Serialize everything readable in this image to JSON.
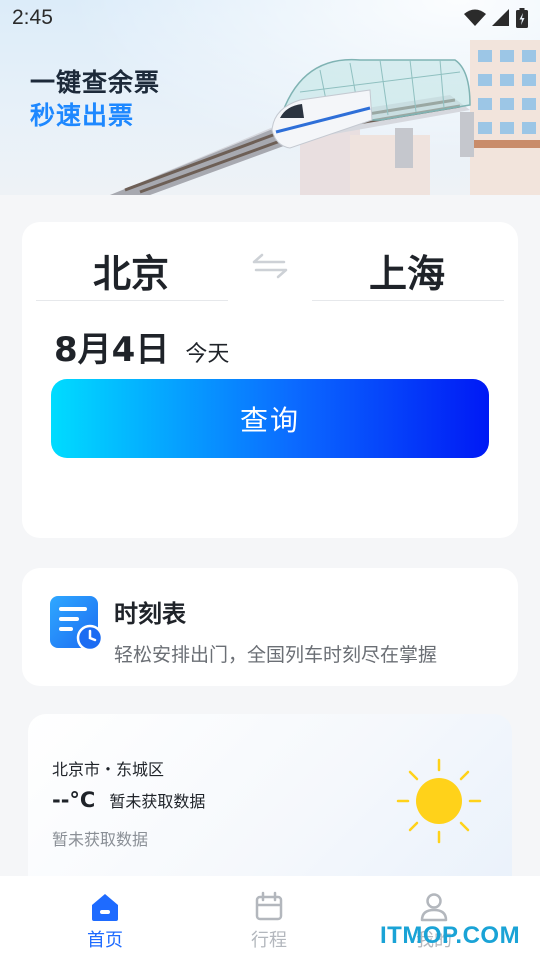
{
  "status_bar": {
    "time": "2:45"
  },
  "hero": {
    "slogan_line1": "一键查余票",
    "slogan_line2": "秒速出票"
  },
  "query": {
    "from_station": "北京",
    "to_station": "上海",
    "date": "8月4日",
    "date_hint": "今天",
    "search_label": "查询"
  },
  "timetable": {
    "title": "时刻表",
    "description": "轻松安排出门，全国列车时刻尽在掌握"
  },
  "weather": {
    "location": "北京市・东城区",
    "temperature": "--°C",
    "condition": "暂未获取数据",
    "note": "暂未获取数据"
  },
  "bottom_nav": {
    "items": [
      {
        "label": "首页",
        "icon": "home-icon",
        "active": true
      },
      {
        "label": "行程",
        "icon": "calendar-icon",
        "active": false
      },
      {
        "label": "我的",
        "icon": "person-icon",
        "active": false
      }
    ]
  },
  "watermark": "ITMOP.COM",
  "colors": {
    "accent": "#1e6bff",
    "slogan_blue": "#1e88ff",
    "button_gradient_start": "#00dcff",
    "button_gradient_end": "#0019f5",
    "sun": "#ffd21a"
  }
}
